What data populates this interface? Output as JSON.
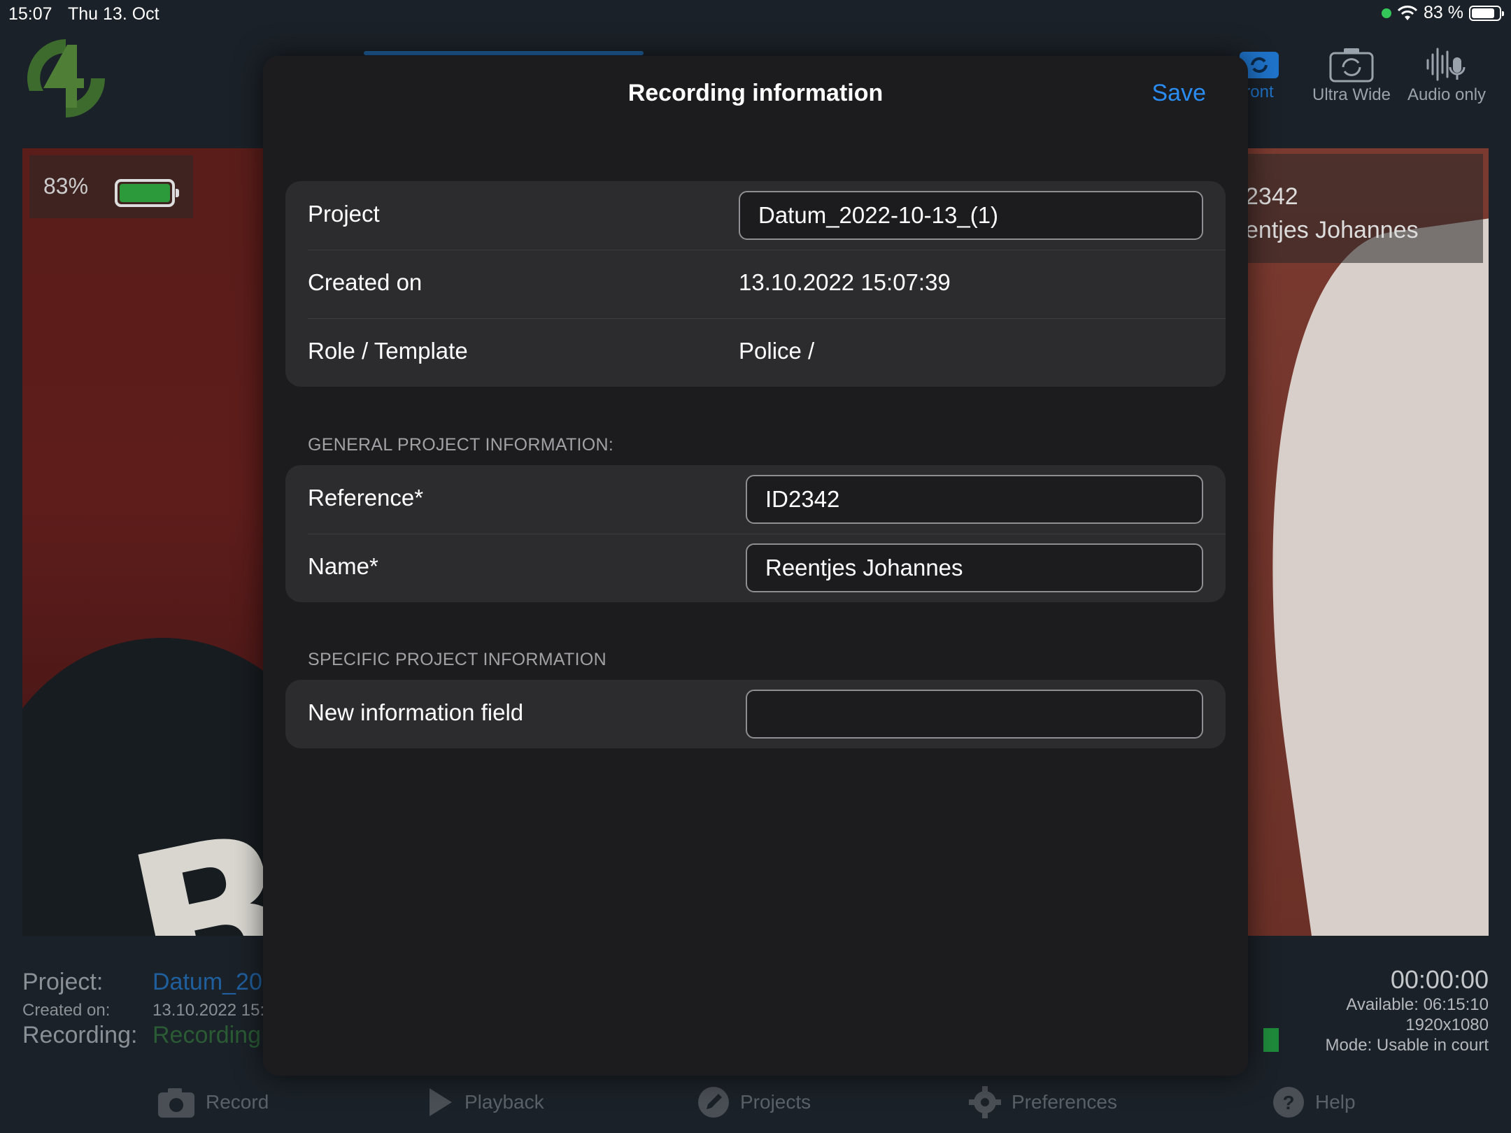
{
  "status_bar": {
    "time": "15:07",
    "date": "Thu 13. Oct",
    "battery_text": "83 %"
  },
  "camera": {
    "front_label": "ront",
    "ultra_wide_label": "Ultra Wide",
    "audio_only_label": "Audio only"
  },
  "preview": {
    "battery_pct": "83%",
    "battery_level": 0.83,
    "overlay_line1": "2342",
    "overlay_line2": "entjes Johannes",
    "shirt_letter": "B"
  },
  "info": {
    "project_label": "Project:",
    "project_value": "Datum_20",
    "created_label": "Created on:",
    "created_value": "13.10.2022 15:",
    "recording_label": "Recording:",
    "recording_value": "Recording",
    "timer": "00:00:00",
    "available": "Available: 06:15:10",
    "resolution": "1920x1080",
    "mode": "Mode: Usable in court"
  },
  "bottom_nav": {
    "record": "Record",
    "playback": "Playback",
    "projects": "Projects",
    "preferences": "Preferences",
    "help": "Help"
  },
  "modal": {
    "title": "Recording information",
    "save_label": "Save",
    "project_label": "Project",
    "project_value": "Datum_2022-10-13_(1)",
    "created_label": "Created on",
    "created_value": "13.10.2022 15:07:39",
    "role_label": "Role / Template",
    "role_value": "Police /",
    "general_header": "GENERAL PROJECT INFORMATION:",
    "reference_label": "Reference*",
    "reference_value": "ID2342",
    "name_label": "Name*",
    "name_value": "Reentjes Johannes",
    "specific_header": "SPECIFIC PROJECT INFORMATION",
    "new_field_label": "New information field",
    "new_field_value": ""
  },
  "colors": {
    "accent": "#2a8cf0",
    "modal_bg": "#1c1c1e",
    "group_bg": "#2c2c2e",
    "battery_green": "#2c9a3a"
  }
}
